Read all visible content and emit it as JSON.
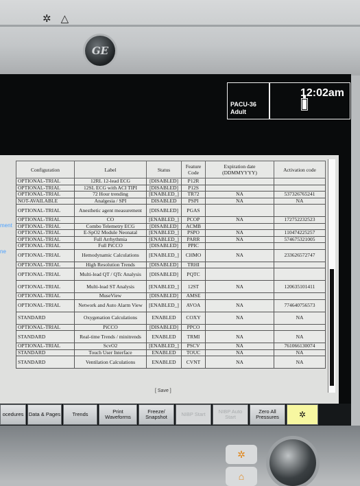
{
  "device": {
    "top_icons": [
      "✲",
      "△"
    ],
    "logo": "GE",
    "patient_location": "PACU-36",
    "patient_category": "Adult",
    "time": "12:02am"
  },
  "side_labels": [
    "ment",
    "ne"
  ],
  "table": {
    "headers": [
      "Configuration",
      "Label",
      "Status",
      "Feature Code",
      "Expiration date (DDMMYYYY)",
      "Activation code"
    ],
    "rows": [
      [
        "OPTIONAL-TRIAL",
        "12RL 12-lead ECG",
        "[DISABLED]",
        "P12R",
        "",
        ""
      ],
      [
        "OPTIONAL-TRIAL",
        "12SL ECG with ACI TIPI",
        "[DISABLED]",
        "P12S",
        "",
        ""
      ],
      [
        "OPTIONAL-TRIAL",
        "72 Hour trending",
        "[ENABLED_]",
        "TR72",
        "NA",
        "537326765241"
      ],
      [
        "NOT-AVAILABLE",
        "Analgesia / SPI",
        "DISABLED",
        "PSPI",
        "NA",
        "NA"
      ],
      [
        "OPTIONAL-TRIAL",
        "Anesthetic agent measurement",
        "[DISABLED]",
        "PGAS",
        "",
        ""
      ],
      [
        "OPTIONAL-TRIAL",
        "CO",
        "[ENABLED_]",
        "PCOP",
        "NA",
        "172752232523"
      ],
      [
        "OPTIONAL-TRIAL",
        "Combo Telemetry ECG",
        "[DISABLED]",
        "ACMB",
        "",
        ""
      ],
      [
        "OPTIONAL-TRIAL",
        "E-SpO2 Module Neonatal",
        "[ENABLED_]",
        "PSPO",
        "NA",
        "110474225257"
      ],
      [
        "OPTIONAL-TRIAL",
        "Full Arrhythmia",
        "[ENABLED_]",
        "PARR",
        "NA",
        "574675321005"
      ],
      [
        "OPTIONAL-TRIAL",
        "Full PiCCO",
        "[DISABLED]",
        "PPIC",
        "",
        ""
      ],
      [
        "OPTIONAL-TRIAL",
        "Hemodynamic Calculations",
        "[ENABLED_]",
        "CHMO",
        "NA",
        "233626572747"
      ],
      [
        "OPTIONAL-TRIAL",
        "High Resolution Trends",
        "[DISABLED]",
        "TRHI",
        "",
        ""
      ],
      [
        "OPTIONAL-TRIAL",
        "Multi-lead QT / QTc Analysis",
        "[DISABLED]",
        "PQTC",
        "",
        ""
      ],
      [
        "OPTIONAL-TRIAL",
        "Multi-lead ST Analysis",
        "[ENABLED_]",
        "12ST",
        "NA",
        "120635101411"
      ],
      [
        "OPTIONAL-TRIAL",
        "MuseView",
        "[DISABLED]",
        "AMSE",
        "",
        ""
      ],
      [
        "OPTIONAL-TRIAL",
        "Network and Auto Alarm View",
        "[ENABLED_]",
        "AVOA",
        "NA",
        "774640756573"
      ],
      [
        "STANDARD",
        "Oxygenation Calculations",
        "ENABLED",
        "COXY",
        "NA",
        "NA"
      ],
      [
        "OPTIONAL-TRIAL",
        "PiCCO",
        "[DISABLED]",
        "PPCO",
        "",
        ""
      ],
      [
        "STANDARD",
        "Real-time Trends / minitrends",
        "ENABLED",
        "TRMI",
        "NA",
        "NA"
      ],
      [
        "OPTIONAL-TRIAL",
        "ScvO2",
        "[ENABLED_]",
        "PSCV",
        "NA",
        "761066130074"
      ],
      [
        "STANDARD",
        "Touch User Interface",
        "ENABLED",
        "TOUC",
        "NA",
        "NA"
      ],
      [
        "STANDARD",
        "Ventilation Calculations",
        "ENABLED",
        "CVNT",
        "NA",
        "NA"
      ]
    ]
  },
  "save_label": "[ Save ]",
  "buttons": [
    {
      "label": "ocedures",
      "enabled": true
    },
    {
      "label": "Data & Pages",
      "enabled": true
    },
    {
      "label": "Trends",
      "enabled": true
    },
    {
      "label": "Print Waveforms",
      "enabled": true
    },
    {
      "label": "Freeze/ Snapshot",
      "enabled": true
    },
    {
      "label": "NIBP Start",
      "enabled": false
    },
    {
      "label": "NIBP Auto Start",
      "enabled": false
    },
    {
      "label": "Zero All Pressures",
      "enabled": true
    },
    {
      "label": "✲",
      "enabled": true
    }
  ],
  "hardware_keys": [
    "✲",
    "⌂"
  ],
  "colors": {
    "screen": "#090b0c",
    "link": "#4ba1ff",
    "alarm_button": "#f7f7a1",
    "alarm_icon": "#e18618"
  }
}
